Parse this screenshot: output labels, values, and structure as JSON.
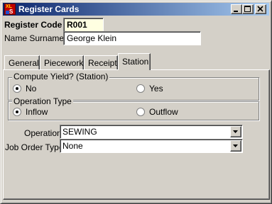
{
  "window": {
    "title": "Register Cards",
    "controls": {
      "minimize": "minimize",
      "maximize": "maximize",
      "close": "close"
    }
  },
  "header": {
    "register_code_label": "Register Code",
    "register_code_value": "R001",
    "name_label": "Name Surname",
    "name_value": "George Klein"
  },
  "tabs": [
    {
      "label": "General",
      "active": false
    },
    {
      "label": "Piecework",
      "active": false
    },
    {
      "label": "Receipt",
      "active": false
    },
    {
      "label": "Station",
      "active": true
    }
  ],
  "station": {
    "compute_yield": {
      "title": "Compute Yield? (Station)",
      "options": [
        {
          "label": "No",
          "selected": true
        },
        {
          "label": "Yes",
          "selected": false
        }
      ]
    },
    "operation_type": {
      "title": "Operation Type",
      "options": [
        {
          "label": "Inflow",
          "selected": true
        },
        {
          "label": "Outflow",
          "selected": false
        }
      ]
    },
    "operation": {
      "label": "Operation",
      "value": "SEWING"
    },
    "job_order_type": {
      "label": "Job Order Type",
      "value": "None"
    }
  },
  "colors": {
    "title_gradient_start": "#0a246a",
    "title_gradient_end": "#a6caf0",
    "face": "#d4d0c8",
    "code_field": "#ffffe1"
  }
}
